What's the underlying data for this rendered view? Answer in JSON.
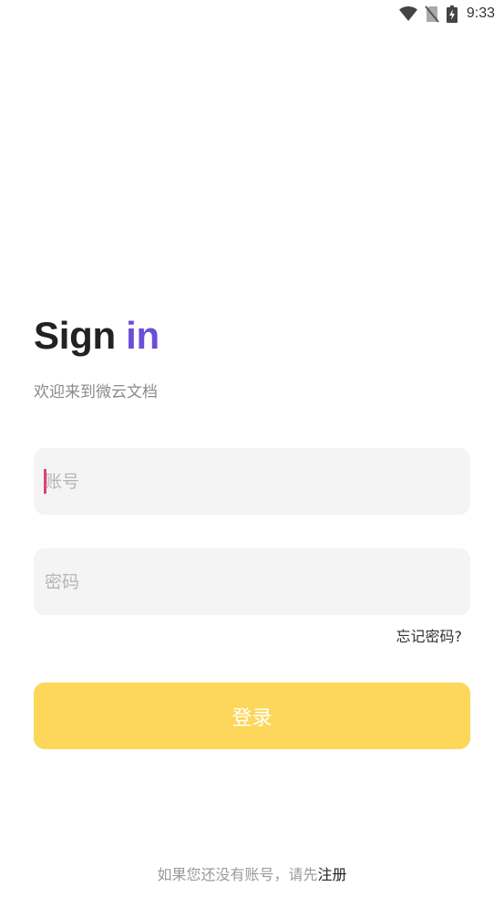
{
  "status_bar": {
    "time": "9:33",
    "icons": [
      "wifi-icon",
      "no-sim-icon",
      "battery-charging-icon"
    ]
  },
  "title": {
    "part1": "Sign",
    "part2": "in"
  },
  "colors": {
    "accent_purple": "#6b4fd8",
    "button_yellow": "#fdd75a",
    "input_bg": "#f4f4f4",
    "caret": "#e0407a"
  },
  "subtitle": "欢迎来到微云文档",
  "account_field": {
    "placeholder": "账号",
    "value": ""
  },
  "password_field": {
    "placeholder": "密码",
    "value": ""
  },
  "forgot_password": "忘记密码?",
  "login_button": "登录",
  "register": {
    "prompt": "如果您还没有账号，请先",
    "link": "注册"
  }
}
